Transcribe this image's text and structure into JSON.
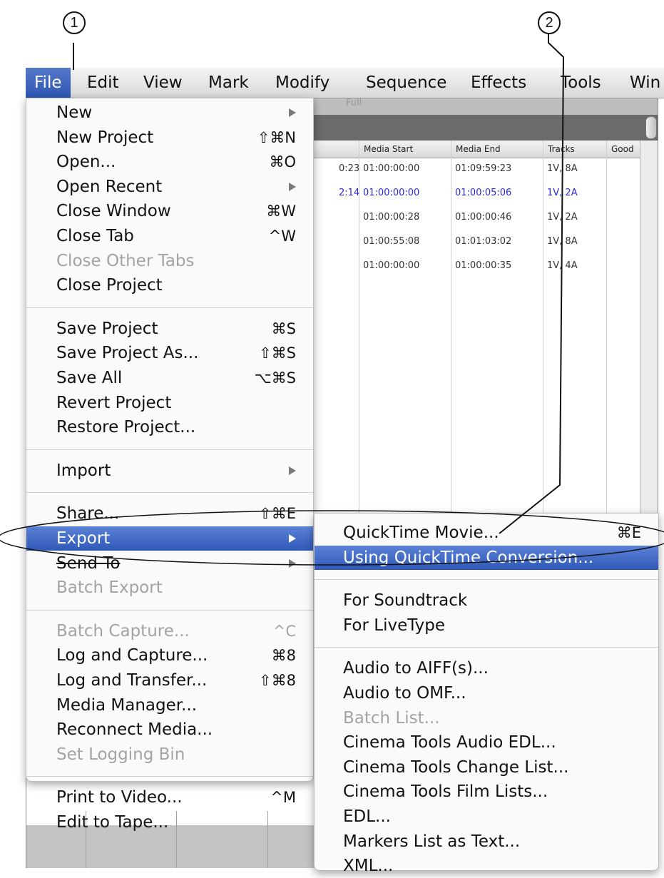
{
  "menubar": {
    "items": [
      "File",
      "Edit",
      "View",
      "Mark",
      "Modify",
      "Sequence",
      "Effects",
      "Tools",
      "Win"
    ]
  },
  "callouts": {
    "one": "1",
    "two": "2"
  },
  "background_window": {
    "title_fragment": "Full",
    "columns": [
      "Media Start",
      "Media End",
      "Tracks",
      "Good"
    ],
    "rows": [
      {
        "left": "0:23",
        "start": "01:00:00:00",
        "end": "01:09:59:23",
        "tracks": "1V, 8A",
        "blue": false
      },
      {
        "left": "2:14",
        "start": "01:00:00:00",
        "end": "01:00:05:06",
        "tracks": "1V, 2A",
        "blue": true
      },
      {
        "left": "",
        "start": "01:00:00:28",
        "end": "01:00:00:46",
        "tracks": "1V, 2A",
        "blue": false
      },
      {
        "left": "",
        "start": "01:00:55:08",
        "end": "01:01:03:02",
        "tracks": "1V, 8A",
        "blue": false
      },
      {
        "left": "",
        "start": "01:00:00:00",
        "end": "01:00:00:35",
        "tracks": "1V, 4A",
        "blue": false
      }
    ]
  },
  "file_menu": {
    "items": [
      {
        "label": "New",
        "shortcut": "",
        "submenu": true,
        "disabled": false
      },
      {
        "label": "New Project",
        "shortcut": "⇧⌘N",
        "submenu": false,
        "disabled": false
      },
      {
        "label": "Open...",
        "shortcut": "⌘O",
        "submenu": false,
        "disabled": false
      },
      {
        "label": "Open Recent",
        "shortcut": "",
        "submenu": true,
        "disabled": false
      },
      {
        "label": "Close Window",
        "shortcut": "⌘W",
        "submenu": false,
        "disabled": false
      },
      {
        "label": "Close Tab",
        "shortcut": "^W",
        "submenu": false,
        "disabled": false
      },
      {
        "label": "Close Other Tabs",
        "shortcut": "",
        "submenu": false,
        "disabled": true
      },
      {
        "label": "Close Project",
        "shortcut": "",
        "submenu": false,
        "disabled": false
      },
      {
        "separator": true
      },
      {
        "label": "Save Project",
        "shortcut": "⌘S",
        "submenu": false,
        "disabled": false
      },
      {
        "label": "Save Project As...",
        "shortcut": "⇧⌘S",
        "submenu": false,
        "disabled": false
      },
      {
        "label": "Save All",
        "shortcut": "⌥⌘S",
        "submenu": false,
        "disabled": false
      },
      {
        "label": "Revert Project",
        "shortcut": "",
        "submenu": false,
        "disabled": false
      },
      {
        "label": "Restore Project...",
        "shortcut": "",
        "submenu": false,
        "disabled": false
      },
      {
        "separator": true
      },
      {
        "label": "Import",
        "shortcut": "",
        "submenu": true,
        "disabled": false
      },
      {
        "separator": true
      },
      {
        "label": "Share...",
        "shortcut": "⇧⌘E",
        "submenu": false,
        "disabled": false
      },
      {
        "label": "Export",
        "shortcut": "",
        "submenu": true,
        "disabled": false,
        "highlighted": true
      },
      {
        "label": "Send To",
        "shortcut": "",
        "submenu": true,
        "disabled": false,
        "strike": true
      },
      {
        "label": "Batch Export",
        "shortcut": "",
        "submenu": false,
        "disabled": true
      },
      {
        "separator": true
      },
      {
        "label": "Batch Capture...",
        "shortcut": "^C",
        "submenu": false,
        "disabled": true
      },
      {
        "label": "Log and Capture...",
        "shortcut": "⌘8",
        "submenu": false,
        "disabled": false
      },
      {
        "label": "Log and Transfer...",
        "shortcut": "⇧⌘8",
        "submenu": false,
        "disabled": false
      },
      {
        "label": "Media Manager...",
        "shortcut": "",
        "submenu": false,
        "disabled": false
      },
      {
        "label": "Reconnect Media...",
        "shortcut": "",
        "submenu": false,
        "disabled": false
      },
      {
        "label": "Set Logging Bin",
        "shortcut": "",
        "submenu": false,
        "disabled": true
      },
      {
        "separator": true
      },
      {
        "label": "Print to Video...",
        "shortcut": "^M",
        "submenu": false,
        "disabled": false
      },
      {
        "label": "Edit to Tape...",
        "shortcut": "",
        "submenu": false,
        "disabled": false
      }
    ]
  },
  "export_menu": {
    "items": [
      {
        "label": "QuickTime Movie...",
        "shortcut": "⌘E",
        "disabled": false
      },
      {
        "label": "Using QuickTime Conversion...",
        "shortcut": "",
        "disabled": false,
        "highlighted": true
      },
      {
        "separator": true
      },
      {
        "label": "For Soundtrack",
        "shortcut": "",
        "disabled": false
      },
      {
        "label": "For LiveType",
        "shortcut": "",
        "disabled": false
      },
      {
        "separator": true
      },
      {
        "label": "Audio to AIFF(s)...",
        "shortcut": "",
        "disabled": false
      },
      {
        "label": "Audio to OMF...",
        "shortcut": "",
        "disabled": false
      },
      {
        "label": "Batch List...",
        "shortcut": "",
        "disabled": true
      },
      {
        "label": "Cinema Tools Audio EDL...",
        "shortcut": "",
        "disabled": false
      },
      {
        "label": "Cinema Tools Change List...",
        "shortcut": "",
        "disabled": false
      },
      {
        "label": "Cinema Tools Film Lists...",
        "shortcut": "",
        "disabled": false
      },
      {
        "label": "EDL...",
        "shortcut": "",
        "disabled": false
      },
      {
        "label": "Markers List as Text...",
        "shortcut": "",
        "disabled": false
      },
      {
        "label": "XML...",
        "shortcut": "",
        "disabled": false
      }
    ]
  },
  "colors": {
    "highlight": "#2f58b8",
    "disabled_text": "#a3a3a3",
    "menu_bg": "#fafafa"
  }
}
